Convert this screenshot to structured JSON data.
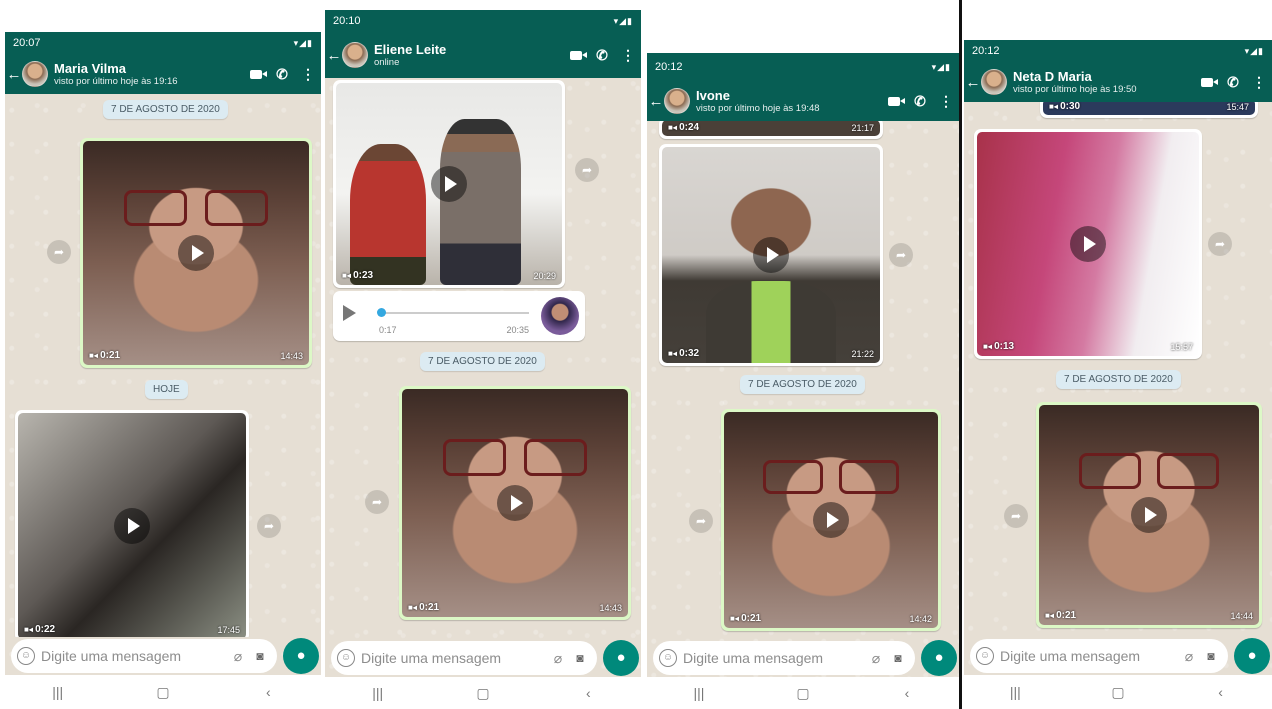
{
  "screens": [
    {
      "time": "20:07",
      "name": "Maria Vilma",
      "status": "visto por último hoje às 19:16",
      "date1": "7 DE AGOSTO DE 2020",
      "date2": "HOJE",
      "video1": {
        "duration": "0:21",
        "time": "14:43"
      },
      "video2": {
        "duration": "0:22",
        "time": "17:45"
      },
      "placeholder": "Digite uma mensagem"
    },
    {
      "time": "20:10",
      "name": "Eliene Leite",
      "status": "online",
      "video0": {
        "duration": "0:23",
        "time": "20:29"
      },
      "audio": {
        "duration": "0:17",
        "time": "20:35"
      },
      "date1": "7 DE AGOSTO DE 2020",
      "video1": {
        "duration": "0:21",
        "time": "14:43"
      },
      "placeholder": "Digite uma mensagem"
    },
    {
      "time": "20:12",
      "name": "Ivone",
      "status": "visto por último hoje às 19:48",
      "video0": {
        "duration": "0:24",
        "time": "21:17"
      },
      "video2": {
        "duration": "0:32",
        "time": "21:22"
      },
      "date1": "7 DE AGOSTO DE 2020",
      "video1": {
        "duration": "0:21",
        "time": "14:42"
      },
      "placeholder": "Digite uma mensagem"
    },
    {
      "time": "20:12",
      "name": "Neta D Maria",
      "status": "visto por último hoje às 19:50",
      "video0": {
        "duration": "0:30",
        "time": "15:47"
      },
      "video2": {
        "duration": "0:13",
        "time": "15:57"
      },
      "date1": "7 DE AGOSTO DE 2020",
      "video1": {
        "duration": "0:21",
        "time": "14:44"
      },
      "placeholder": "Digite uma mensagem"
    }
  ],
  "icons": {
    "back": "arrow-left-icon",
    "video": "video-call-icon",
    "call": "phone-icon",
    "menu": "more-vert-icon",
    "forward": "forward-icon",
    "emoji": "emoji-icon",
    "attach": "paperclip-icon",
    "camera": "camera-icon",
    "mic": "microphone-icon"
  },
  "colors": {
    "header": "#075e54",
    "outgoing": "#dcf8c6",
    "mic": "#00897b",
    "date_chip": "#dcebf2"
  }
}
